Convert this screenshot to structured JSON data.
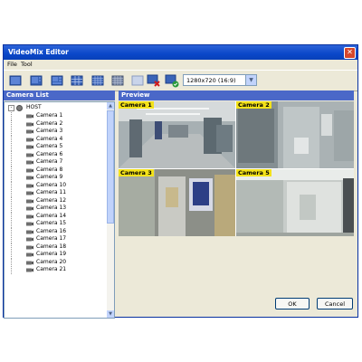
{
  "window": {
    "title": "VideoMix Editor",
    "close_glyph": "✕"
  },
  "menu": [
    "File",
    "Tool"
  ],
  "toolbar": {
    "icons": [
      "layout-1x1-icon",
      "layout-2x2-icon",
      "layout-3-icon",
      "layout-3x3-icon",
      "layout-4x4-icon",
      "layout-blank-icon",
      "layout-delete-icon",
      "layout-apply-icon"
    ],
    "resolution": "1280x720 (16:9)"
  },
  "camera_list": {
    "title": "Camera List",
    "host": "HOST",
    "cameras": [
      "Camera 1",
      "Camera 2",
      "Camera 3",
      "Camera 4",
      "Camera 5",
      "Camera 6",
      "Camera 7",
      "Camera 8",
      "Camera 9",
      "Camera 10",
      "Camera 11",
      "Camera 12",
      "Camera 13",
      "Camera 14",
      "Camera 15",
      "Camera 16",
      "Camera 17",
      "Camera 18",
      "Camera 19",
      "Camera 20",
      "Camera 21"
    ]
  },
  "preview": {
    "title": "Preview",
    "tiles": [
      "Camera 1",
      "Camera 2",
      "Camera 3",
      "Camera 5"
    ]
  },
  "buttons": {
    "ok": "OK",
    "cancel": "Cancel"
  },
  "colors": {
    "title_bar": "#0a47c9",
    "panel_header": "#4a68c8",
    "camera_label": "#f3e21a"
  }
}
